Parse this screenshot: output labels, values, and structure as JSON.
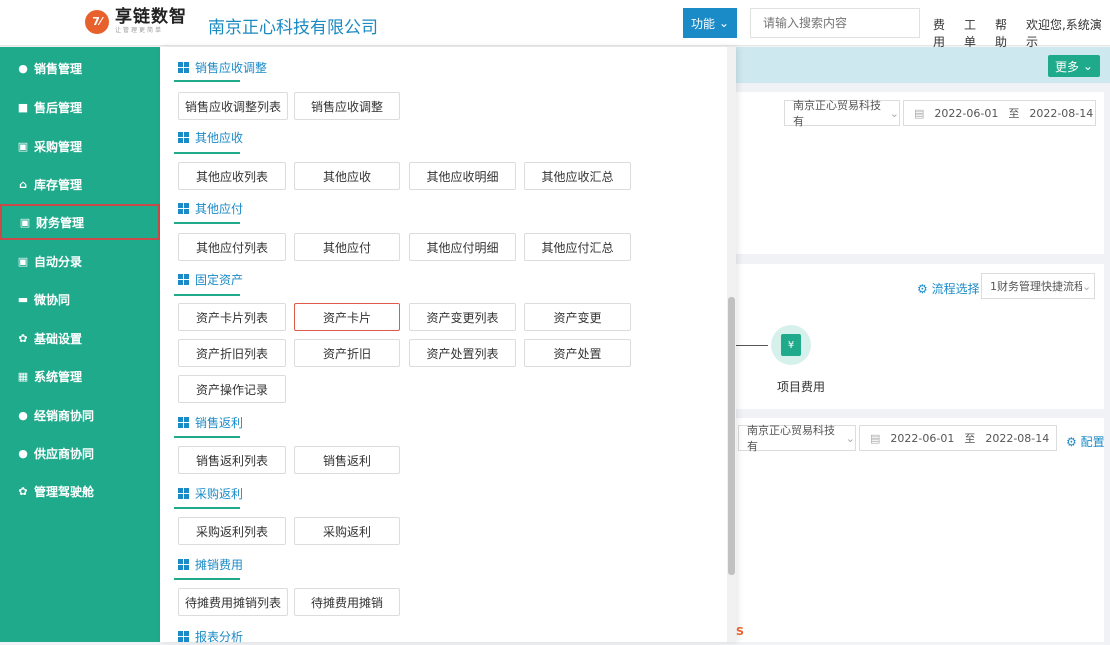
{
  "header": {
    "logo_mark": "7⁄",
    "logo_name": "享链数智",
    "logo_sub": "让管理更简单",
    "company": "南京正心科技有限公司",
    "func_label": "功能",
    "search_placeholder": "请输入搜索内容",
    "links": [
      "费用",
      "工单",
      "帮助",
      "欢迎您,系统演示"
    ]
  },
  "sidebar": {
    "items": [
      {
        "label": "销售管理",
        "icon": "person-icon"
      },
      {
        "label": "售后管理",
        "icon": "id-card-icon"
      },
      {
        "label": "采购管理",
        "icon": "cart-icon"
      },
      {
        "label": "库存管理",
        "icon": "warehouse-icon"
      },
      {
        "label": "财务管理",
        "icon": "finance-icon"
      },
      {
        "label": "自动分录",
        "icon": "ledger-icon"
      },
      {
        "label": "微协同",
        "icon": "chat-icon"
      },
      {
        "label": "基础设置",
        "icon": "gear-icon"
      },
      {
        "label": "系统管理",
        "icon": "grid-icon"
      },
      {
        "label": "经销商协同",
        "icon": "person-icon"
      },
      {
        "label": "供应商协同",
        "icon": "person-icon"
      },
      {
        "label": "管理驾驶舱",
        "icon": "gear-icon"
      }
    ],
    "active_index": 4
  },
  "background": {
    "more_label": "更多",
    "company_select_1": "南京正心贸易科技有",
    "date_start_1": "2022-06-01",
    "date_to_1": "至",
    "date_end_1": "2022-08-14",
    "flow_label": "流程选择",
    "flow_select": "1财务管理快捷流程",
    "project_label": "项目费用",
    "company_select_2": "南京正心贸易科技有",
    "date_start_2": "2022-06-01",
    "date_to_2": "至",
    "date_end_2": "2022-08-14",
    "config_label": "配置"
  },
  "menu": {
    "groups": [
      {
        "title": "销售应收调整",
        "buttons": [
          "销售应收调整列表",
          "销售应收调整"
        ]
      },
      {
        "title": "其他应收",
        "buttons": [
          "其他应收列表",
          "其他应收",
          "其他应收明细",
          "其他应收汇总"
        ]
      },
      {
        "title": "其他应付",
        "buttons": [
          "其他应付列表",
          "其他应付",
          "其他应付明细",
          "其他应付汇总"
        ]
      },
      {
        "title": "固定资产",
        "buttons": [
          "资产卡片列表",
          "资产卡片",
          "资产变更列表",
          "资产变更",
          "资产折旧列表",
          "资产折旧",
          "资产处置列表",
          "资产处置",
          "资产操作记录"
        ]
      },
      {
        "title": "销售返利",
        "buttons": [
          "销售返利列表",
          "销售返利"
        ]
      },
      {
        "title": "采购返利",
        "buttons": [
          "采购返利列表",
          "采购返利"
        ]
      },
      {
        "title": "摊销费用",
        "buttons": [
          "待摊费用摊销列表",
          "待摊费用摊销"
        ]
      },
      {
        "title": "报表分析",
        "buttons": []
      }
    ],
    "selected": "资产卡片"
  },
  "colors": {
    "sidebar": "#1faa8c",
    "accent": "#1b8bc7",
    "selected_border": "#e05a4a"
  }
}
